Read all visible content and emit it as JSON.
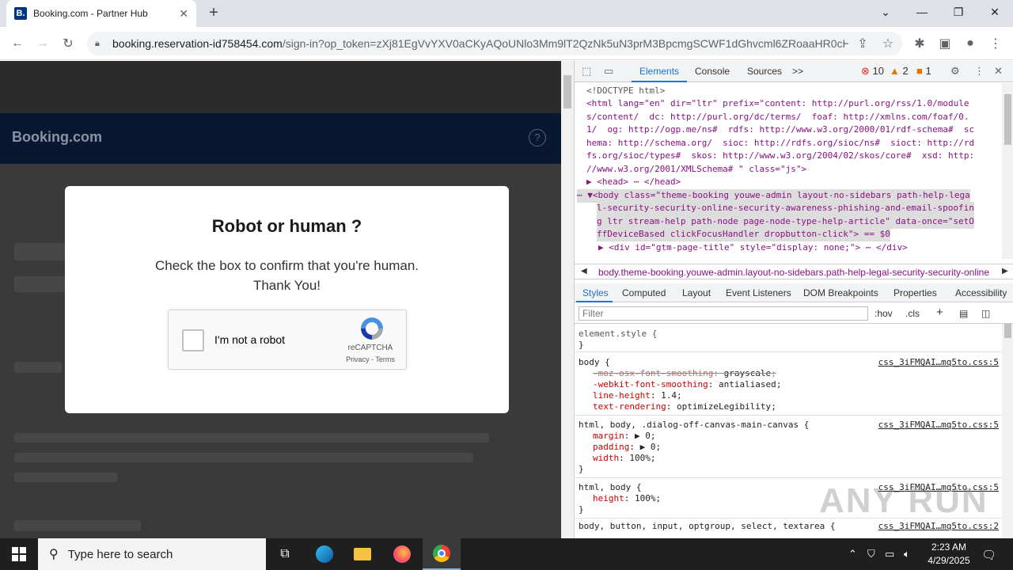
{
  "browser": {
    "tab_title": "Booking.com - Partner Hub",
    "tab_favicon": "B.",
    "url_host": "booking.reservation-id758454.com",
    "url_path": "/sign-in?op_token=zXj81EgVvYXV0aCKyAQoUNlo3Mm9lT2QzNk5uN3prM3BpcmgSCWF1dGhvcml6ZRoaaHR0cH..."
  },
  "page": {
    "brand": "Booking.com",
    "help_icon": "?"
  },
  "modal": {
    "title": "Robot or human ?",
    "line1": "Check the box to confirm that you're human.",
    "line2": "Thank You!",
    "captcha_label": "I'm not a robot",
    "captcha_brand": "reCAPTCHA",
    "captcha_privacy": "Privacy",
    "captcha_sep": " - ",
    "captcha_terms": "Terms"
  },
  "devtools": {
    "tabs": [
      "Elements",
      "Console",
      "Sources",
      ">>"
    ],
    "errors": "10",
    "warnings": "2",
    "issues": "1",
    "dom_lines": [
      "<!DOCTYPE html>",
      "<html lang=\"en\" dir=\"ltr\" prefix=\"content: http://purl.org/rss/1.0/module",
      "s/content/  dc: http://purl.org/dc/terms/  foaf: http://xmlns.com/foaf/0.",
      "1/  og: http://ogp.me/ns#  rdfs: http://www.w3.org/2000/01/rdf-schema#  sc",
      "hema: http://schema.org/  sioc: http://rdfs.org/sioc/ns#  sioct: http://rd",
      "fs.org/sioc/types#  skos: http://www.w3.org/2004/02/skos/core#  xsd: http:",
      "//www.w3.org/2001/XMLSchema# \" class=\"js\">",
      "▶ <head> ⋯ </head>",
      "⋯ ▼<body class=\"theme-booking youwe-admin layout-no-sidebars path-help-lega",
      "l-security-security-online-security-awareness-phishing-and-email-spoofin",
      "g ltr stream-help path-node page-node-type-help-article\" data-once=\"setO",
      "ffDeviceBased clickFocusHandler dropbutton-click\"> == $0",
      "▶ <div id=\"gtm-page-title\" style=\"display: none;\"> ⋯ </div>"
    ],
    "breadcrumb": "body.theme-booking.youwe-admin.layout-no-sidebars.path-help-legal-security-security-online",
    "subtabs": [
      "Styles",
      "Computed",
      "Layout",
      "Event Listeners",
      "DOM Breakpoints",
      "Properties",
      "Accessibility"
    ],
    "filter_placeholder": "Filter",
    "filter_hov": ":hov",
    "filter_cls": ".cls",
    "rules": [
      {
        "selector": "element.style {",
        "source": "",
        "props": [],
        "close": "}"
      },
      {
        "selector": "body {",
        "source": "css_3iFMQAI…mq5to.css:5",
        "props": [
          {
            "name": "-moz-osx-font-smoothing",
            "value": "grayscale",
            "strike": true
          },
          {
            "name": "-webkit-font-smoothing",
            "value": "antialiased",
            "strike": false
          },
          {
            "name": "line-height",
            "value": "1.4",
            "strike": false
          },
          {
            "name": "text-rendering",
            "value": "optimizeLegibility",
            "strike": false
          }
        ],
        "close": "}"
      },
      {
        "selector": "html, body, .dialog-off-canvas-main-canvas {",
        "source": "css_3iFMQAI…mq5to.css:5",
        "props": [
          {
            "name": "margin",
            "value": "▶ 0",
            "strike": false
          },
          {
            "name": "padding",
            "value": "▶ 0",
            "strike": false
          },
          {
            "name": "width",
            "value": "100%",
            "strike": false
          }
        ],
        "close": "}"
      },
      {
        "selector": "html, body {",
        "source": "css_3iFMQAI…mq5to.css:5",
        "props": [
          {
            "name": "height",
            "value": "100%",
            "strike": false
          }
        ],
        "close": "}"
      },
      {
        "selector": "body, button, input, optgroup, select, textarea {",
        "source": "css_3iFMQAI…mq5to.css:2",
        "props": [],
        "close": ""
      }
    ],
    "watermark": "ANY RUN"
  },
  "taskbar": {
    "search_placeholder": "Type here to search",
    "time": "2:23 AM",
    "date": "4/29/2025"
  }
}
